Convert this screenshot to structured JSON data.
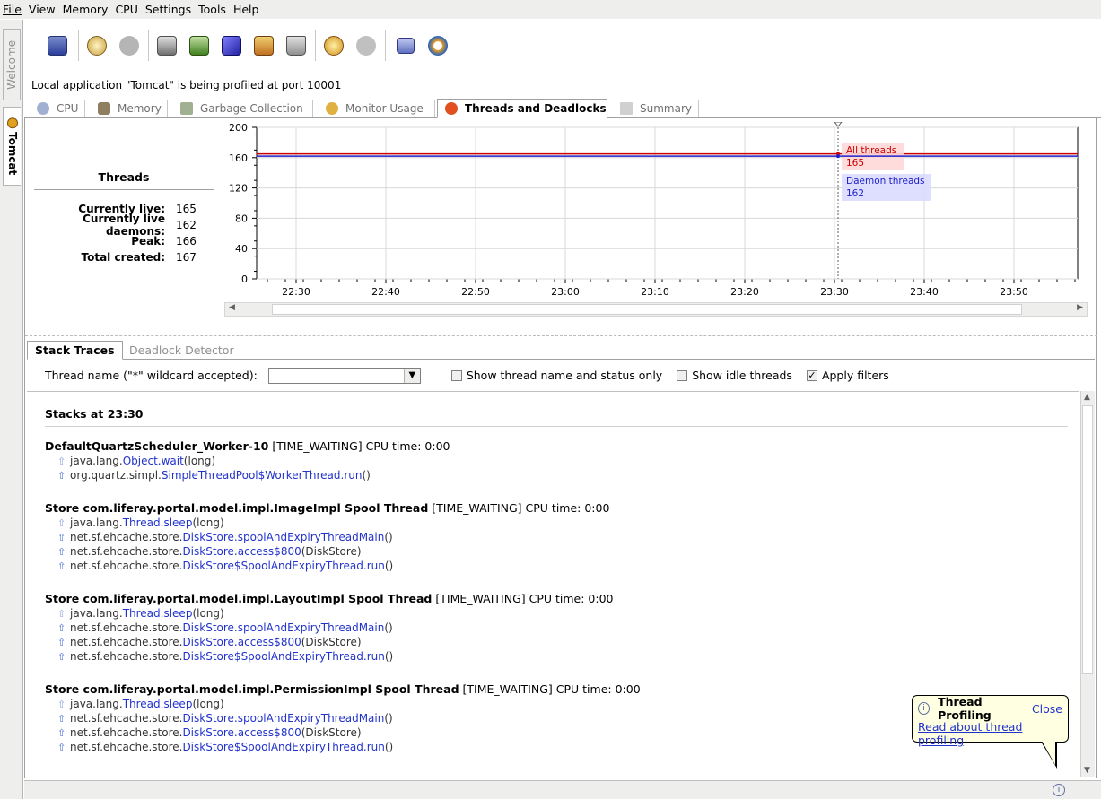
{
  "menu": [
    "File",
    "View",
    "Memory",
    "CPU",
    "Settings",
    "Tools",
    "Help"
  ],
  "side_tabs": {
    "welcome": "Welcome",
    "tomcat": "Tomcat"
  },
  "toolbar_icons": [
    "save-snapshot-icon",
    "run-gc-icon",
    "memory-snapshot-icon",
    "export-icon",
    "import-icon",
    "book-icon",
    "thread-dump-icon",
    "trash-icon",
    "settings-icon",
    "gear-disabled-icon",
    "pause-icon",
    "refresh-icon"
  ],
  "status_text": "Local application \"Tomcat\" is being profiled at port 10001",
  "main_tabs": [
    {
      "label": "CPU",
      "icon": "cpu-icon"
    },
    {
      "label": "Memory",
      "icon": "memory-icon"
    },
    {
      "label": "Garbage Collection",
      "icon": "garbage-icon"
    },
    {
      "label": "Monitor Usage",
      "icon": "monitor-icon"
    },
    {
      "label": "Threads and Deadlocks",
      "icon": "threads-icon"
    },
    {
      "label": "Summary",
      "icon": "summary-icon"
    }
  ],
  "threads": {
    "title": "Threads",
    "stats": [
      {
        "label": "Currently live:",
        "value": "165"
      },
      {
        "label": "Currently live daemons:",
        "value": "162"
      },
      {
        "label": "Peak:",
        "value": "166"
      },
      {
        "label": "Total created:",
        "value": "167"
      }
    ]
  },
  "chart_data": {
    "type": "line",
    "x_ticks": [
      "22:30",
      "22:40",
      "22:50",
      "23:00",
      "23:10",
      "23:20",
      "23:30",
      "23:40",
      "23:50"
    ],
    "y_ticks": [
      "0",
      "40",
      "80",
      "120",
      "160",
      "200"
    ],
    "ylim": [
      0,
      200
    ],
    "grid": true,
    "cursor_x": "23:30",
    "series": [
      {
        "name": "All threads",
        "value": 165,
        "color": "#cc0000"
      },
      {
        "name": "Daemon threads",
        "value": 162,
        "color": "#2020cc"
      }
    ]
  },
  "sub_tabs": [
    "Stack Traces",
    "Deadlock Detector"
  ],
  "filter": {
    "label": "Thread name (\"*\" wildcard accepted):",
    "value": "",
    "checkboxes": [
      {
        "label": "Show thread name and status only",
        "checked": false
      },
      {
        "label": "Show idle threads",
        "checked": false
      },
      {
        "label": "Apply filters",
        "checked": true
      }
    ]
  },
  "stacks": {
    "title": "Stacks at 23:30",
    "threads": [
      {
        "name": "DefaultQuartzScheduler_Worker-10",
        "state": "[TIME_WAITING]",
        "cpu": "CPU time: 0:00",
        "frames": [
          {
            "cls": "java.lang.",
            "meth": "Object.wait",
            "args": "(long)"
          },
          {
            "cls": "org.quartz.simpl.",
            "meth": "SimpleThreadPool$WorkerThread.run",
            "args": "()"
          }
        ]
      },
      {
        "name": "Store com.liferay.portal.model.impl.ImageImpl Spool Thread",
        "state": "[TIME_WAITING]",
        "cpu": "CPU time: 0:00",
        "frames": [
          {
            "cls": "java.lang.",
            "meth": "Thread.sleep",
            "args": "(long)"
          },
          {
            "cls": "net.sf.ehcache.store.",
            "meth": "DiskStore.spoolAndExpiryThreadMain",
            "args": "()"
          },
          {
            "cls": "net.sf.ehcache.store.",
            "meth": "DiskStore.access$800",
            "args": "(DiskStore)"
          },
          {
            "cls": "net.sf.ehcache.store.",
            "meth": "DiskStore$SpoolAndExpiryThread.run",
            "args": "()"
          }
        ]
      },
      {
        "name": "Store com.liferay.portal.model.impl.LayoutImpl Spool Thread",
        "state": "[TIME_WAITING]",
        "cpu": "CPU time: 0:00",
        "frames": [
          {
            "cls": "java.lang.",
            "meth": "Thread.sleep",
            "args": "(long)"
          },
          {
            "cls": "net.sf.ehcache.store.",
            "meth": "DiskStore.spoolAndExpiryThreadMain",
            "args": "()"
          },
          {
            "cls": "net.sf.ehcache.store.",
            "meth": "DiskStore.access$800",
            "args": "(DiskStore)"
          },
          {
            "cls": "net.sf.ehcache.store.",
            "meth": "DiskStore$SpoolAndExpiryThread.run",
            "args": "()"
          }
        ]
      },
      {
        "name": "Store com.liferay.portal.model.impl.PermissionImpl Spool Thread",
        "state": "[TIME_WAITING]",
        "cpu": "CPU time: 0:00",
        "frames": [
          {
            "cls": "java.lang.",
            "meth": "Thread.sleep",
            "args": "(long)"
          },
          {
            "cls": "net.sf.ehcache.store.",
            "meth": "DiskStore.spoolAndExpiryThreadMain",
            "args": "()"
          },
          {
            "cls": "net.sf.ehcache.store.",
            "meth": "DiskStore.access$800",
            "args": "(DiskStore)"
          },
          {
            "cls": "net.sf.ehcache.store.",
            "meth": "DiskStore$SpoolAndExpiryThread.run",
            "args": "()"
          }
        ]
      }
    ]
  },
  "balloon": {
    "title": "Thread Profiling",
    "close": "Close",
    "link": "Read about thread profiling"
  }
}
